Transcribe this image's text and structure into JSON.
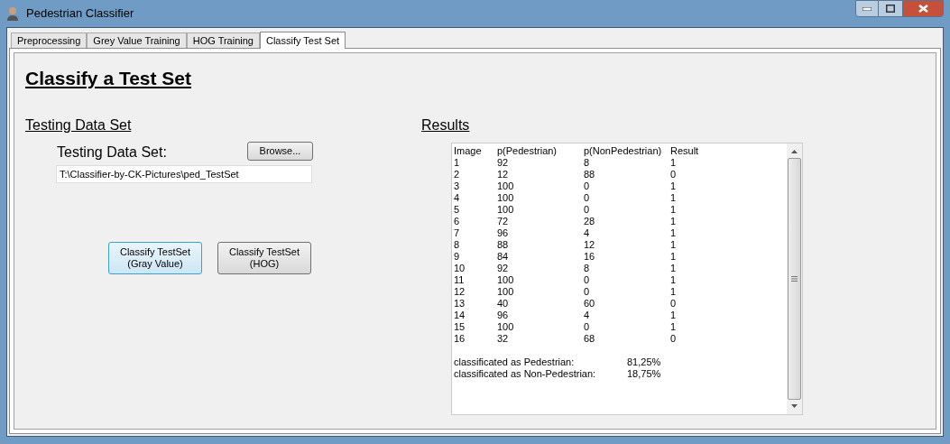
{
  "window": {
    "title": "Pedestrian Classifier"
  },
  "tabs": [
    {
      "label": "Preprocessing",
      "selected": false
    },
    {
      "label": "Grey Value Training",
      "selected": false
    },
    {
      "label": "HOG Training",
      "selected": false
    },
    {
      "label": "Classify Test Set",
      "selected": true
    }
  ],
  "heading": "Classify a Test Set",
  "testing": {
    "title": "Testing Data Set",
    "label": "Testing Data Set:",
    "browse_button": "Browse...",
    "path_value": "T:\\Classifier-by-CK-Pictures\\ped_TestSet"
  },
  "classify_buttons": [
    {
      "lines": [
        "Classify TestSet",
        "(Gray Value)"
      ],
      "focused": true
    },
    {
      "lines": [
        "Classify TestSet",
        "(HOG)"
      ],
      "focused": false
    }
  ],
  "results": {
    "title": "Results",
    "columns": [
      "Image",
      "p(Pedestrian)",
      "p(NonPedestrian)",
      "Result"
    ],
    "rows": [
      [
        "1",
        "92",
        "8",
        "1"
      ],
      [
        "2",
        "12",
        "88",
        "0"
      ],
      [
        "3",
        "100",
        "0",
        "1"
      ],
      [
        "4",
        "100",
        "0",
        "1"
      ],
      [
        "5",
        "100",
        "0",
        "1"
      ],
      [
        "6",
        "72",
        "28",
        "1"
      ],
      [
        "7",
        "96",
        "4",
        "1"
      ],
      [
        "8",
        "88",
        "12",
        "1"
      ],
      [
        "9",
        "84",
        "16",
        "1"
      ],
      [
        "10",
        "92",
        "8",
        "1"
      ],
      [
        "11",
        "100",
        "0",
        "1"
      ],
      [
        "12",
        "100",
        "0",
        "1"
      ],
      [
        "13",
        "40",
        "60",
        "0"
      ],
      [
        "14",
        "96",
        "4",
        "1"
      ],
      [
        "15",
        "100",
        "0",
        "1"
      ],
      [
        "16",
        "32",
        "68",
        "0"
      ]
    ],
    "summary": [
      {
        "label": "classificated as Pedestrian:",
        "value": "81,25%"
      },
      {
        "label": "classificated as Non-Pedestrian:",
        "value": "18,75%"
      }
    ]
  }
}
